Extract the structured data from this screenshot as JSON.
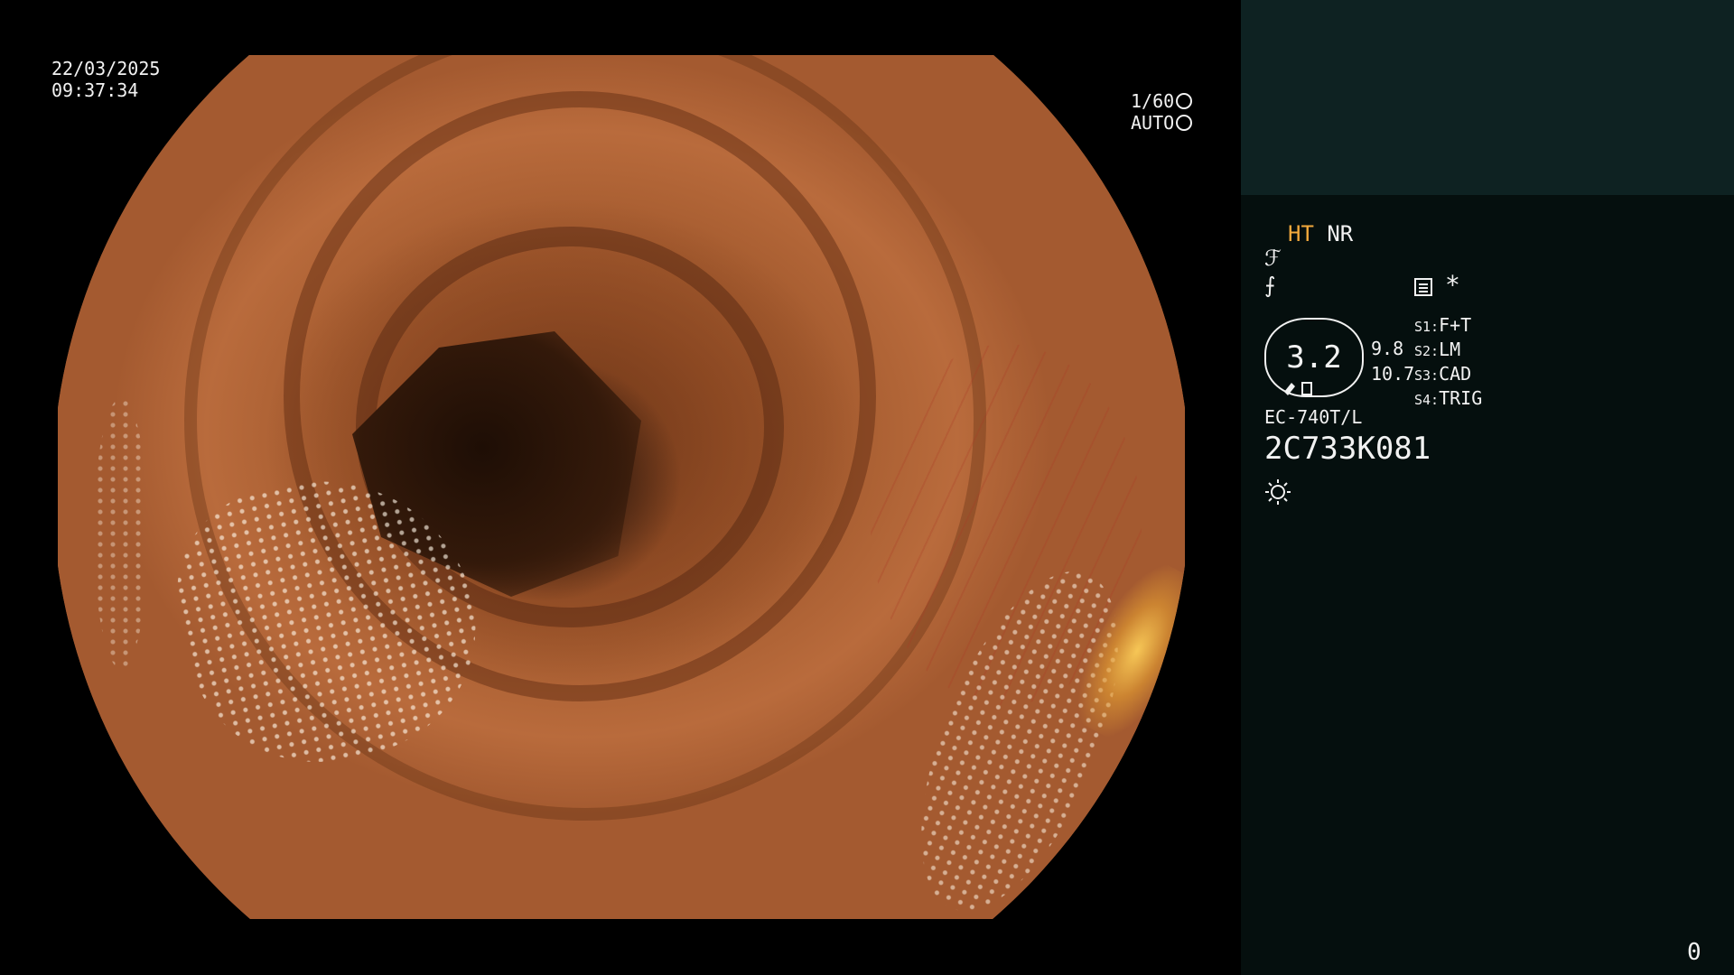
{
  "overlay": {
    "date": "22/03/2025",
    "time": "09:37:34",
    "shutter": "1/60",
    "exposure": "AUTO"
  },
  "panel": {
    "mode_ht": "HT",
    "mode_nr": "NR",
    "glyph_a": "ℱ",
    "glyph_b": "⨍",
    "asterisk": "*",
    "scope_value": "3.2",
    "value_1": "9.8",
    "value_2": "10.7",
    "switches": [
      {
        "key": "S1:",
        "value": "F+T"
      },
      {
        "key": "S2:",
        "value": "LM"
      },
      {
        "key": "S3:",
        "value": "CAD"
      },
      {
        "key": "S4:",
        "value": "TRIG"
      }
    ],
    "model": "EC-740T/L",
    "serial": "2C733K081"
  },
  "counter": "0",
  "icons": [
    "aperture-icon",
    "iris-icon",
    "memo-icon",
    "light-icon",
    "scope-tip-icon"
  ],
  "colors": {
    "highlight": "#f3a93c",
    "panel_bg": "#050f0e",
    "panel_top": "#0e2222"
  }
}
